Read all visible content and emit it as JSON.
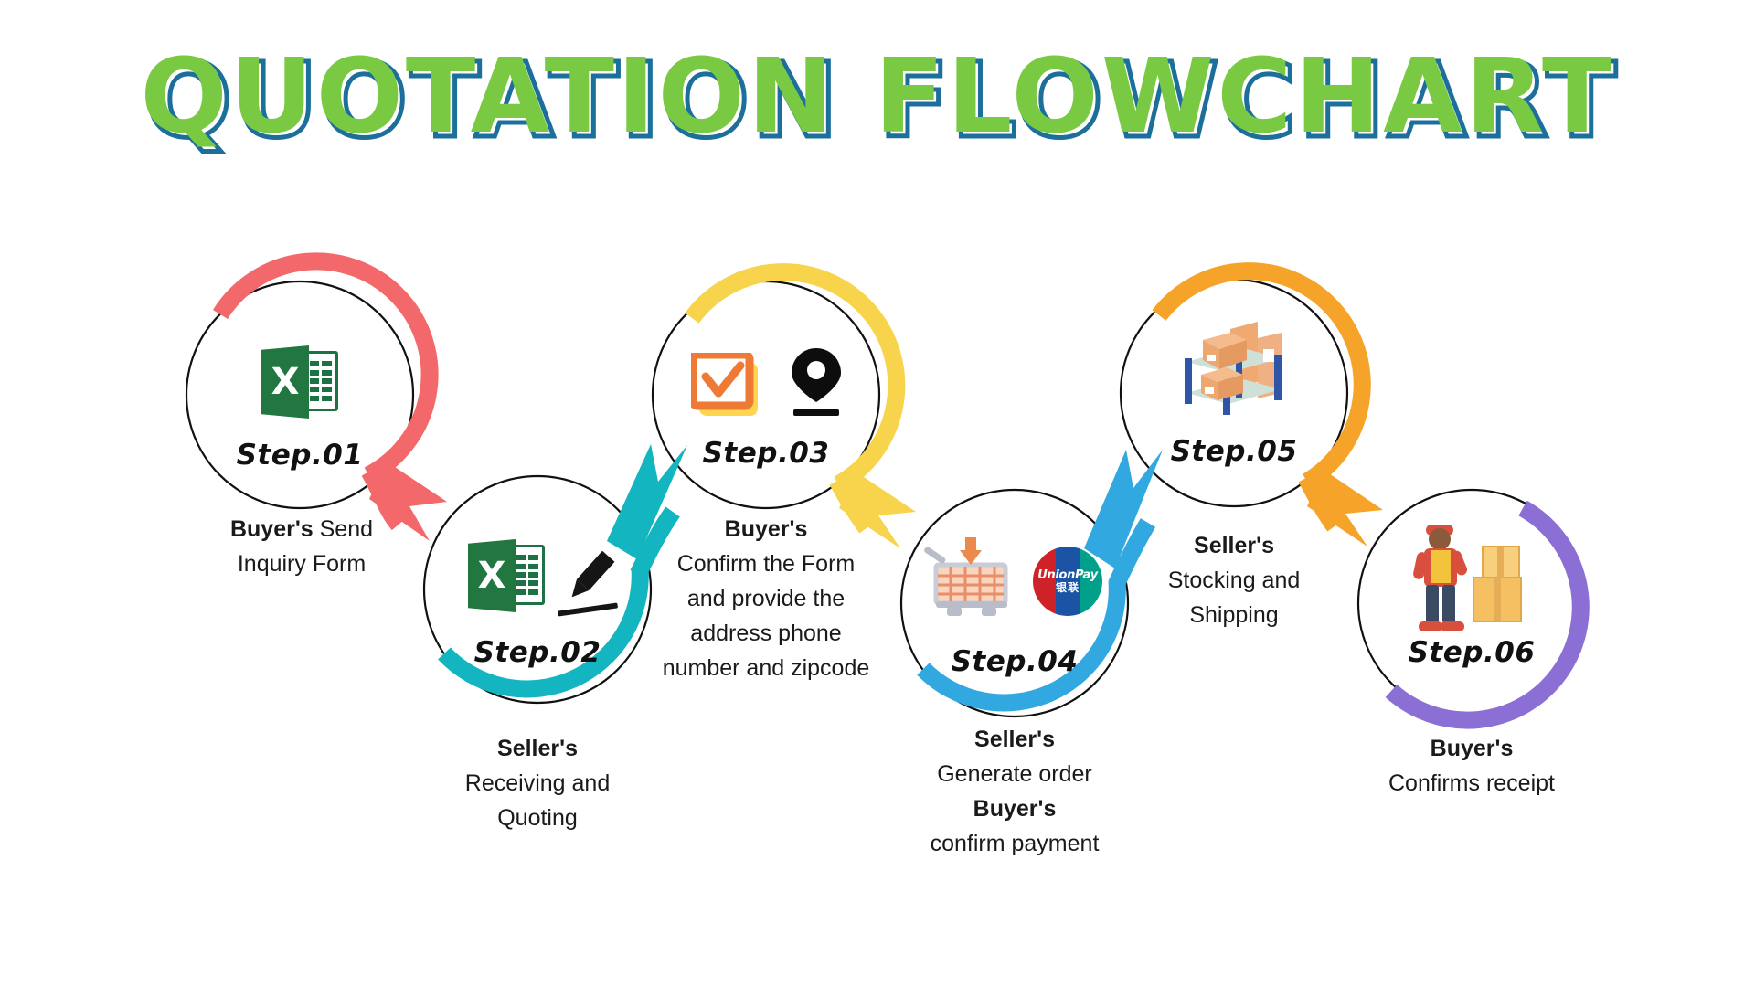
{
  "page": {
    "title": "QUOTATION FLOWCHART",
    "background": "#ffffff",
    "title_fill": "#7ac943",
    "title_outline": "#1b6f9a"
  },
  "steps": [
    {
      "id": "step-01",
      "label": "Step.01",
      "arc_color": "#f2686b",
      "arrow_color": "#f2686b",
      "icons": [
        "excel-icon"
      ],
      "caption": {
        "who": "Buyer's",
        "lines": [
          "Buyer's Send",
          "Inquiry Form"
        ],
        "line1_rest": " Send",
        "line2": "Inquiry Form"
      }
    },
    {
      "id": "step-02",
      "label": "Step.02",
      "arc_color": "#12b5c0",
      "arrow_color": "#12b5c0",
      "icons": [
        "excel-icon",
        "pencil-icon"
      ],
      "caption": {
        "who": "Seller's",
        "lines": [
          "Seller's",
          "Receiving and",
          "Quoting"
        ],
        "line2": "Receiving and",
        "line3": "Quoting"
      }
    },
    {
      "id": "step-03",
      "label": "Step.03",
      "arc_color": "#f7d44c",
      "arrow_color": "#f7d44c",
      "icons": [
        "checkbox-icon",
        "map-pin-icon"
      ],
      "caption": {
        "who": "Buyer's",
        "lines": [
          "Buyer's",
          "Confirm the Form",
          "and provide the",
          "address phone",
          "number and zipcode"
        ],
        "line2": "Confirm the Form",
        "line3": "and provide the",
        "line4": "address phone",
        "line5": "number and zipcode"
      }
    },
    {
      "id": "step-04",
      "label": "Step.04",
      "arc_color": "#31a9e0",
      "arrow_color": "#31a9e0",
      "icons": [
        "shopping-cart-icon",
        "unionpay-icon"
      ],
      "caption": {
        "who": "Seller's",
        "lines": [
          "Seller's",
          "Generate order",
          "Buyer's",
          "confirm payment"
        ],
        "line2": "Generate order",
        "line3": "Buyer's",
        "line4": "confirm payment"
      }
    },
    {
      "id": "step-05",
      "label": "Step.05",
      "arc_color": "#f6a32a",
      "arrow_color": "#f6a32a",
      "icons": [
        "warehouse-rack-icon"
      ],
      "caption": {
        "who": "Seller's",
        "lines": [
          "Seller's",
          "Stocking and",
          "Shipping"
        ],
        "line2": "Stocking and",
        "line3": "Shipping"
      }
    },
    {
      "id": "step-06",
      "label": "Step.06",
      "arc_color": "#8b6fd4",
      "arrow_color": "#8b6fd4",
      "icons": [
        "delivery-person-icon"
      ],
      "caption": {
        "who": "Buyer's",
        "lines": [
          "Buyer's",
          "Confirms receipt"
        ],
        "line2": "Confirms receipt"
      }
    }
  ],
  "icons": {
    "excel_letter": "X",
    "unionpay_text_top": "UnionPay",
    "unionpay_text_bottom": "银联"
  }
}
